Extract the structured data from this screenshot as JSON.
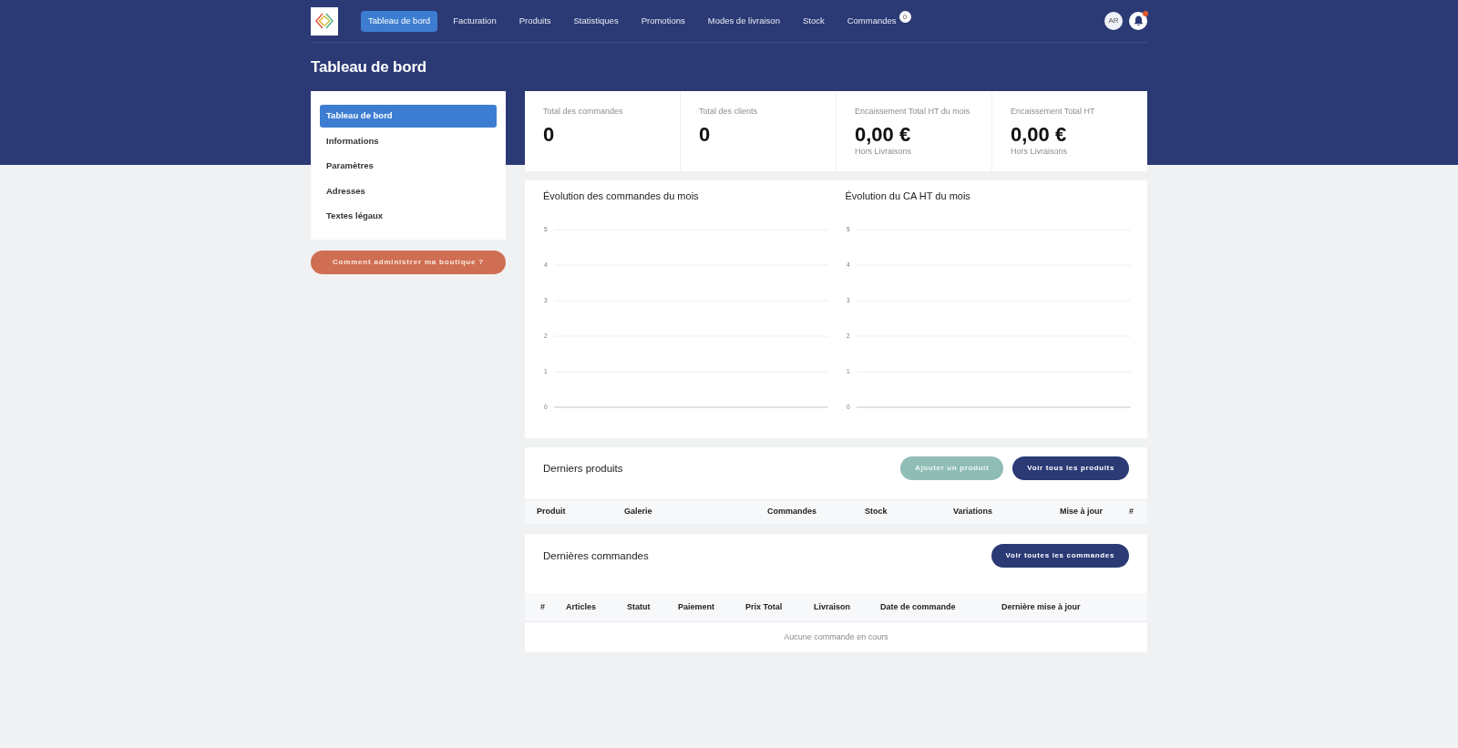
{
  "nav": {
    "items": [
      {
        "label": "Tableau de bord",
        "selected": true
      },
      {
        "label": "Facturation",
        "selected": false
      },
      {
        "label": "Produits",
        "selected": false
      },
      {
        "label": "Statistiques",
        "selected": false
      },
      {
        "label": "Promotions",
        "selected": false
      },
      {
        "label": "Modes de livraison",
        "selected": false
      },
      {
        "label": "Stock",
        "selected": false
      },
      {
        "label": "Commandes",
        "selected": false,
        "badge": "0"
      }
    ],
    "avatar": "AR",
    "notifications": {
      "unread": true
    }
  },
  "page_title": "Tableau de bord",
  "sidebar": {
    "items": [
      {
        "label": "Tableau de bord",
        "selected": true
      },
      {
        "label": "Informations",
        "selected": false
      },
      {
        "label": "Paramètres",
        "selected": false
      },
      {
        "label": "Adresses",
        "selected": false
      },
      {
        "label": "Textes légaux",
        "selected": false
      }
    ],
    "help_button": "Comment administrer ma boutique ?"
  },
  "stats": [
    {
      "label": "Total des commandes",
      "value": "0"
    },
    {
      "label": "Total des clients",
      "value": "0"
    },
    {
      "label": "Encaissement Total HT du mois",
      "value": "0,00 €",
      "note": "Hors Livraisons"
    },
    {
      "label": "Encaissement Total HT",
      "value": "0,00 €",
      "note": "Hors Livraisons"
    }
  ],
  "charts": [
    {
      "title": "Évolution des commandes du mois",
      "y_axis_labels": [
        "5",
        "4",
        "3",
        "2",
        "1",
        "0"
      ]
    },
    {
      "title": "Évolution du CA HT du mois",
      "y_axis_labels": [
        "5",
        "4",
        "3",
        "2",
        "1",
        "0"
      ]
    }
  ],
  "products": {
    "title": "Derniers produits",
    "buttons": [
      {
        "label": "Ajouter un produit",
        "kind": "secondary"
      },
      {
        "label": "Voir tous les produits",
        "kind": "primary"
      }
    ],
    "table": {
      "columns": [
        "Produit",
        "Galerie",
        "Commandes",
        "Stock",
        "Variations",
        "Mise à jour",
        "#"
      ]
    }
  },
  "orders": {
    "title": "Dernières commandes",
    "buttons": [
      {
        "label": "Voir toutes les commandes",
        "kind": "primary"
      }
    ],
    "table": {
      "columns": [
        "#",
        "Articles",
        "Statut",
        "Paiement",
        "Prix Total",
        "Livraison",
        "Date de commande",
        "Dernière mise à jour"
      ],
      "empty_message": "Aucune commande en cours"
    }
  }
}
